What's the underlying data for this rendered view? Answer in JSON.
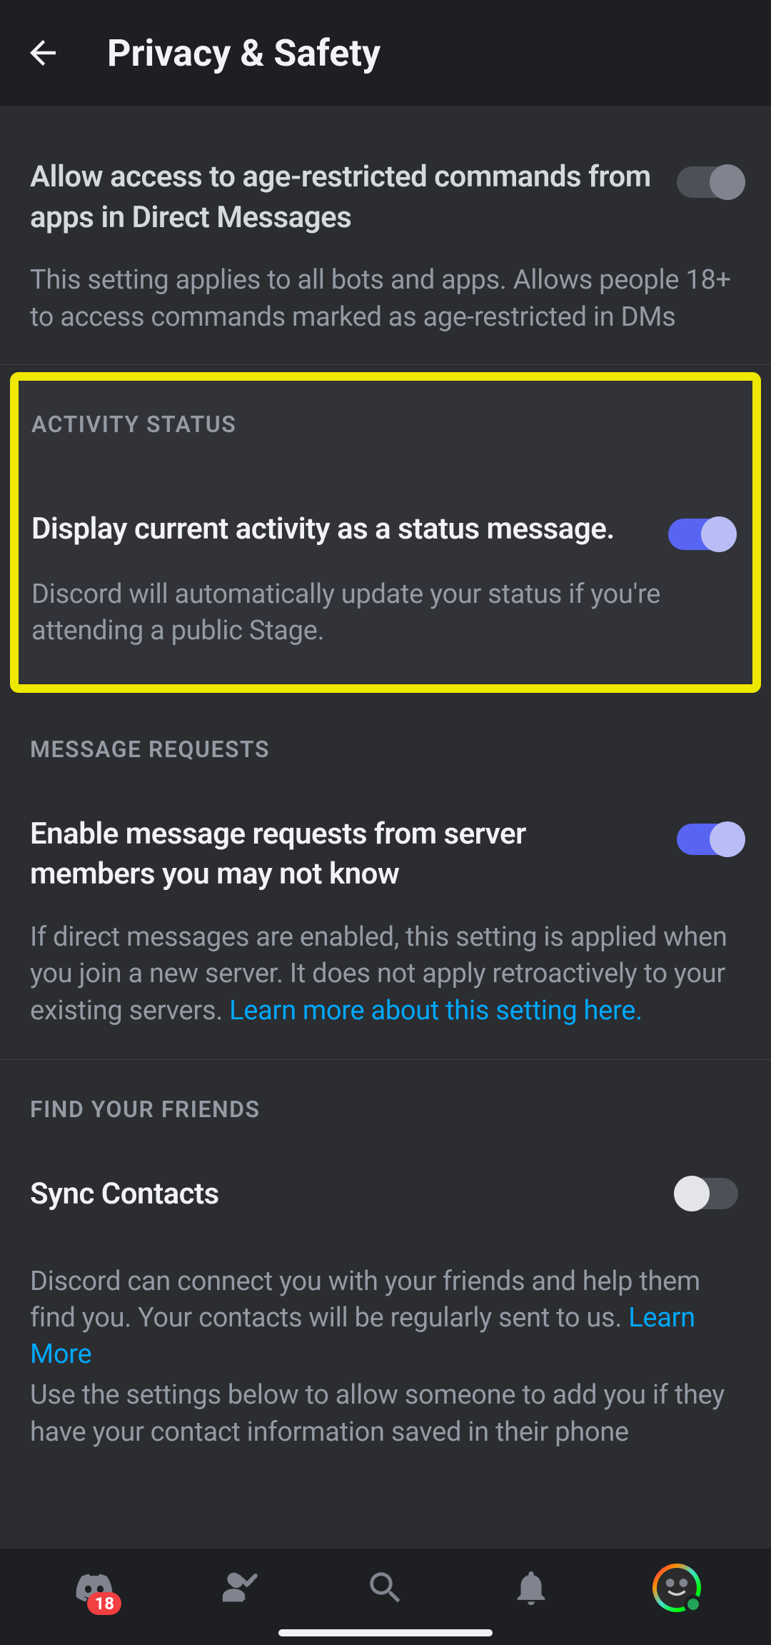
{
  "header": {
    "title": "Privacy & Safety"
  },
  "settings": {
    "age_restricted": {
      "label": "Allow access to age-restricted commands from apps in Direct Messages",
      "desc": "This setting applies to all bots and apps. Allows people 18+ to access commands marked as age-restricted in DMs",
      "enabled": false
    },
    "activity_status": {
      "header": "ACTIVITY STATUS",
      "label": "Display current activity as a status message.",
      "desc": "Discord will automatically update your status if you're attending a public Stage.",
      "enabled": true
    },
    "message_requests": {
      "header": "MESSAGE REQUESTS",
      "label": "Enable message requests from server members you may not know",
      "desc_part1": "If direct messages are enabled, this setting is applied when you join a new server. It does not apply retroactively to your existing servers. ",
      "link": "Learn more about this setting here.",
      "enabled": true
    },
    "find_friends": {
      "header": "FIND YOUR FRIENDS",
      "sync_label": "Sync Contacts",
      "desc_part1": "Discord can connect you with your friends and help them find you. Your contacts will be regularly sent to us. ",
      "link": "Learn More",
      "desc_part2": "Use the settings below to allow someone to add you if they have your contact information saved in their phone",
      "enabled": false
    }
  },
  "nav": {
    "badge_count": "18"
  }
}
